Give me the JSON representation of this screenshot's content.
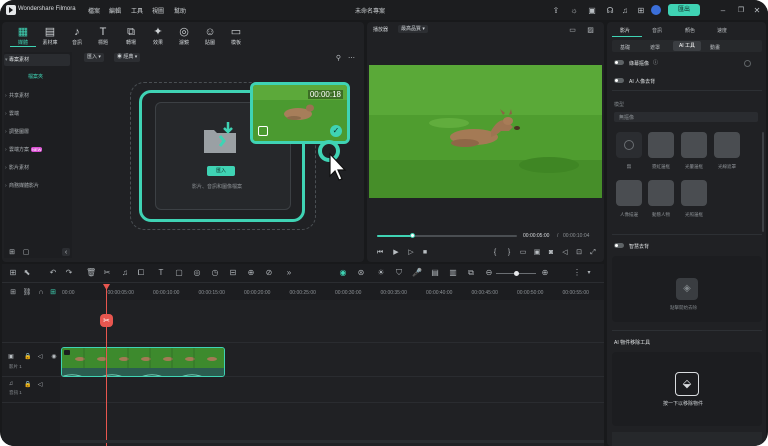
{
  "app": {
    "name": "Wondershare Filmora",
    "menu": [
      "檔案",
      "編輯",
      "工具",
      "視圖",
      "幫助"
    ],
    "project_title": "未命名專案",
    "export_label": "匯出"
  },
  "media_tabs": [
    {
      "label": "媒體",
      "icon": "media-icon"
    },
    {
      "label": "素材庫",
      "icon": "stock-icon"
    },
    {
      "label": "音訊",
      "icon": "music-icon"
    },
    {
      "label": "標題",
      "icon": "title-icon"
    },
    {
      "label": "轉場",
      "icon": "transition-icon"
    },
    {
      "label": "效果",
      "icon": "effects-icon"
    },
    {
      "label": "濾鏡",
      "icon": "filter-icon"
    },
    {
      "label": "貼圖",
      "icon": "sticker-icon"
    },
    {
      "label": "模板",
      "icon": "template-icon"
    }
  ],
  "sidebar": {
    "items": [
      "專案素材",
      "檔案夾",
      "共享素材",
      "雲端",
      "調整圖層",
      "雲端方案",
      "影片素材",
      "商務媒體影片"
    ],
    "badge": "NEW"
  },
  "media_toolbar": {
    "import_label": "匯入",
    "view_label": "經典"
  },
  "drop_zone": {
    "import_button": "匯入",
    "hint": "影片、音訊和圖像檔案"
  },
  "drag_preview": {
    "duration": "00:00:18"
  },
  "player": {
    "quality_label": "播放器",
    "quality_value": "最高品質",
    "current_time": "00:00:05:00",
    "separator": "/",
    "total_time": "00:00:10:04",
    "progress": 0.25
  },
  "timeline": {
    "ruler": [
      "00:00",
      "00:00:05:00",
      "00:00:10:00",
      "00:00:15:00",
      "00:00:20:00",
      "00:00:25:00",
      "00:00:30:00",
      "00:00:35:00",
      "00:00:40:00",
      "00:00:45:00",
      "00:00:50:00",
      "00:00:55:00"
    ],
    "video_track_label": "影片 1",
    "audio_track_label": "音訊 1"
  },
  "right_panel": {
    "main_tabs": [
      "影片",
      "音訊",
      "顏色",
      "速度"
    ],
    "sub_tabs": [
      "基礎",
      "遮罩",
      "AI 工具",
      "動畫"
    ],
    "active_sub": "AI 工具",
    "toggle1": "綠幕摳像",
    "toggle2": "AI 人像去背",
    "section_label": "模型",
    "select_placeholder": "無摳像",
    "thumb_labels": [
      "無",
      "霓虹邊框",
      "光暈邊框",
      "光線遮罩",
      "雙重陰影",
      "人像描邊",
      "動態人物",
      "光照邊框"
    ],
    "toggle3": "智慧去背",
    "smart_hint": "點擊開始去除",
    "ai_object_title": "AI 物件移除工具",
    "ai_object_hint": "按一下以移除物件"
  },
  "colors": {
    "accent": "#3fd3b4",
    "playhead": "#e8564f",
    "bg": "#18191b",
    "panel": "#202124"
  }
}
